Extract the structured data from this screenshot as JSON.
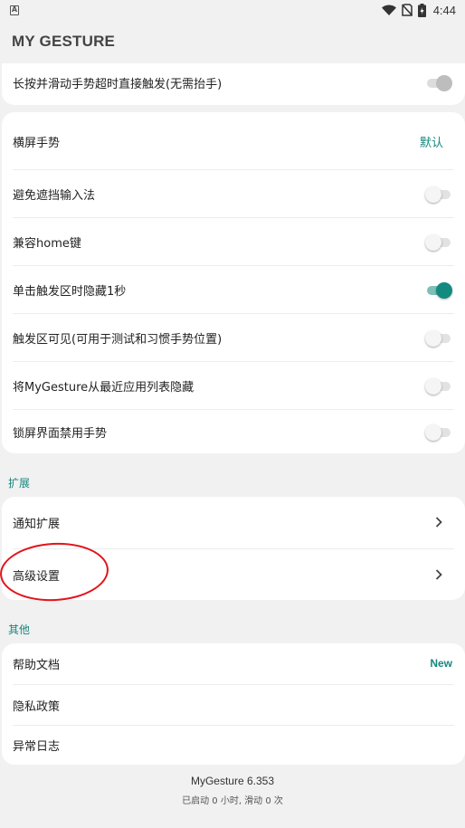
{
  "status_bar": {
    "notification_icon": "text-a-icon",
    "icons": [
      "wifi-icon",
      "sim-off-icon",
      "battery-charging-icon"
    ],
    "time": "4:44"
  },
  "app_bar": {
    "title": "MY GESTURE"
  },
  "top_card": {
    "label": "长按并滑动手势超时直接触发(无需抬手)",
    "toggle": {
      "on": true,
      "enabled": false
    }
  },
  "settings": {
    "landscape": {
      "label": "横屏手势",
      "value": "默认"
    },
    "items": [
      {
        "label": "避免遮挡输入法",
        "on": false
      },
      {
        "label": "兼容home键",
        "on": false
      },
      {
        "label": "单击触发区时隐藏1秒",
        "on": true
      },
      {
        "label": "触发区可见(可用于测试和习惯手势位置)",
        "on": false
      },
      {
        "label": "将MyGesture从最近应用列表隐藏",
        "on": false
      },
      {
        "label": "锁屏界面禁用手势",
        "on": false
      }
    ]
  },
  "extensions": {
    "header": "扩展",
    "items": [
      {
        "label": "通知扩展"
      },
      {
        "label": "高级设置"
      }
    ]
  },
  "other": {
    "header": "其他",
    "items": [
      {
        "label": "帮助文档",
        "badge": "New"
      },
      {
        "label": "隐私政策"
      },
      {
        "label": "异常日志"
      }
    ]
  },
  "footer": {
    "version": "MyGesture 6.353",
    "stats": "已启动 0 小时, 滑动 0 次"
  },
  "colors": {
    "accent": "#17877d",
    "toggle_on_thumb": "#128a7f",
    "background": "#f1f1f1",
    "annotation": "#e3131b"
  }
}
